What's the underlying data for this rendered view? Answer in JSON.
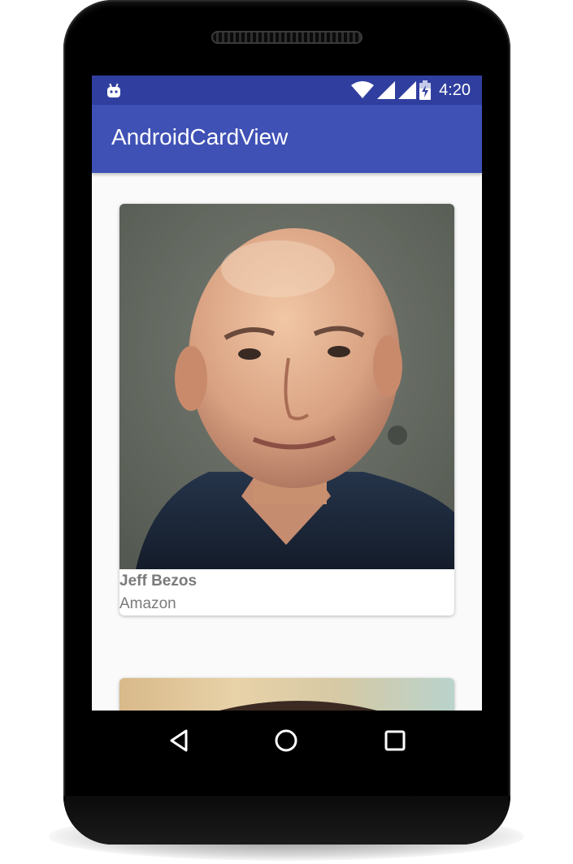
{
  "status_bar": {
    "time": "4:20",
    "icons": [
      "android-notification-icon",
      "wifi-icon",
      "signal-icon",
      "signal-icon",
      "battery-charging-icon"
    ],
    "color": "#303f9f"
  },
  "app_bar": {
    "title": "AndroidCardView",
    "color": "#3f51b5"
  },
  "cards": [
    {
      "name": "Jeff Bezos",
      "company": "Amazon",
      "image": "portrait-photo"
    },
    {
      "image": "portrait-photo"
    }
  ],
  "nav_bar": {
    "buttons": [
      "back-icon",
      "home-icon",
      "recents-icon"
    ]
  }
}
